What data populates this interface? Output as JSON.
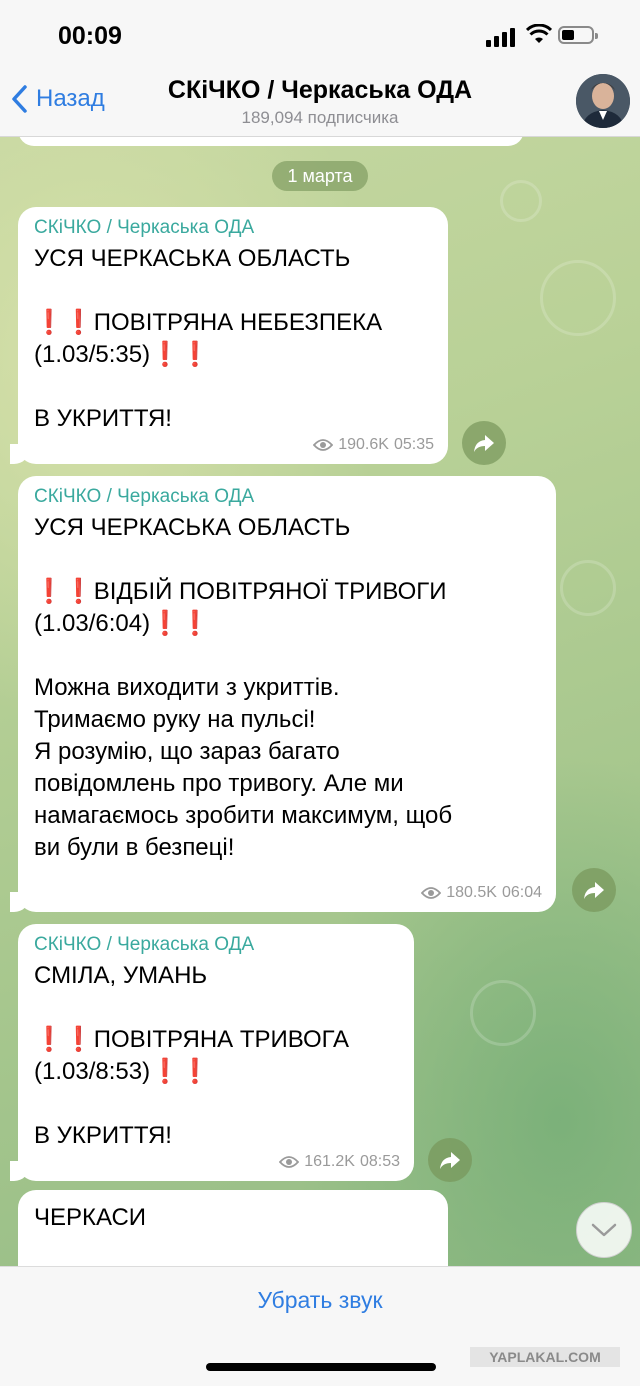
{
  "status_bar": {
    "time": "00:09"
  },
  "nav": {
    "back_label": "Назад",
    "title": "СКіЧКО / Черкаська ОДА",
    "subtitle": "189,094 подписчика"
  },
  "date_label": "1 марта",
  "messages": [
    {
      "author": "СКіЧКО / Черкаська ОДА",
      "line1": "УСЯ ЧЕРКАСЬКА ОБЛАСТЬ",
      "ex": "❗❗",
      "alert": "ПОВІТРЯНА НЕБЕЗПЕКА",
      "stamp": "(1.03/5:35)",
      "tail_text": "В УКРИТТЯ!",
      "views": "190.6K",
      "time": "05:35"
    },
    {
      "author": "СКіЧКО / Черкаська ОДА",
      "line1": "УСЯ ЧЕРКАСЬКА ОБЛАСТЬ",
      "ex": "❗❗",
      "alert": "ВІДБІЙ ПОВІТРЯНОЇ ТРИВОГИ",
      "stamp": "(1.03/6:04)",
      "tail_text": "Можна виходити з укриттів.\nТримаємо руку на пульсі!\nЯ розумію, що зараз багато\nповідомлень про тривогу. Але ми\nнамагаємось зробити максимум, щоб\nви були в безпеці!",
      "views": "180.5K",
      "time": "06:04"
    },
    {
      "author": "СКіЧКО / Черкаська ОДА",
      "line1": "СМІЛА, УМАНЬ",
      "ex": "❗❗",
      "alert": "ПОВІТРЯНА ТРИВОГА",
      "stamp": "(1.03/8:53)",
      "tail_text": "В УКРИТТЯ!",
      "views": "161.2K",
      "time": "08:53"
    },
    {
      "line1": "ЧЕРКАСИ"
    }
  ],
  "bottom": {
    "mute_label": "Убрать звук"
  },
  "watermark": "YAPLAKAL.COM",
  "colors": {
    "accent": "#2f7de1",
    "author": "#3aa99e",
    "alert": "#e0232a"
  },
  "icons": [
    "back-chevron-icon",
    "eye-icon",
    "share-icon",
    "chevron-down-icon",
    "signal-icon",
    "wifi-icon",
    "battery-icon"
  ]
}
